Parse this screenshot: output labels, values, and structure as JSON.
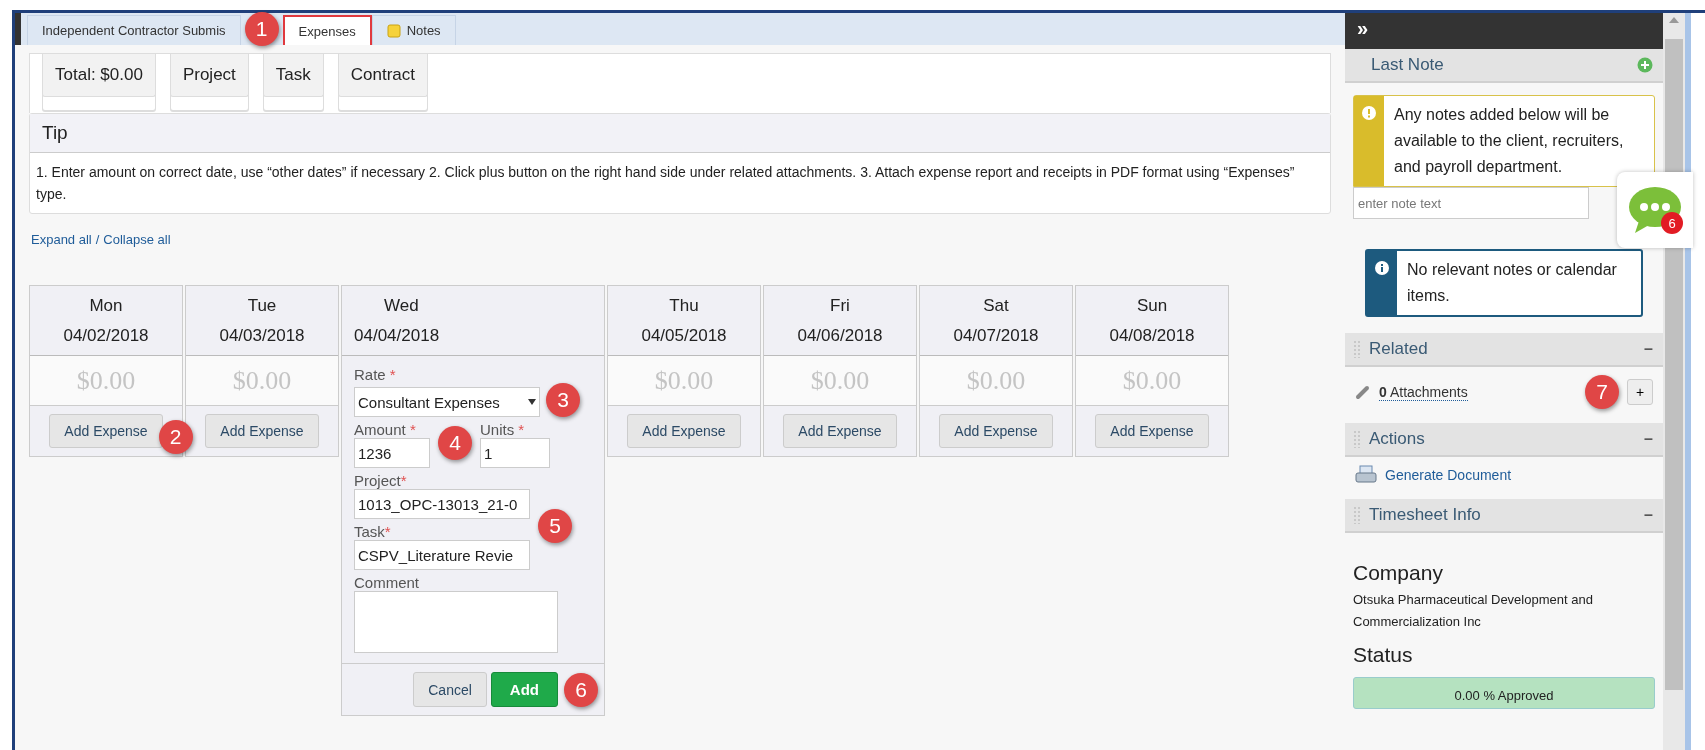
{
  "tabs": [
    {
      "label": "Independent Contractor Submis",
      "selected": false,
      "kind": "plain"
    },
    {
      "label": "Expenses",
      "selected": true,
      "kind": "plain"
    },
    {
      "label": "Notes",
      "selected": false,
      "kind": "note"
    }
  ],
  "summary": [
    "Total: $0.00",
    "Project",
    "Task",
    "Contract"
  ],
  "tip": {
    "title": "Tip",
    "text": "1. Enter amount on correct date, use “other dates” if necessary 2. Click plus button on the right hand side under related attachments. 3. Attach expense report and receipts in PDF format using “Expenses” type."
  },
  "expand_links": {
    "expand": "Expand all",
    "separator": "/",
    "collapse": "Collapse all"
  },
  "days": [
    {
      "day": "Mon",
      "date": "04/02/2018",
      "amount": "$0.00",
      "button": "Add Expense",
      "expanded": false
    },
    {
      "day": "Tue",
      "date": "04/03/2018",
      "amount": "$0.00",
      "button": "Add Expense",
      "expanded": false
    },
    {
      "day": "Wed",
      "date": "04/04/2018",
      "expanded": true
    },
    {
      "day": "Thu",
      "date": "04/05/2018",
      "amount": "$0.00",
      "button": "Add Expense",
      "expanded": false
    },
    {
      "day": "Fri",
      "date": "04/06/2018",
      "amount": "$0.00",
      "button": "Add Expense",
      "expanded": false
    },
    {
      "day": "Sat",
      "date": "04/07/2018",
      "amount": "$0.00",
      "button": "Add Expense",
      "expanded": false
    },
    {
      "day": "Sun",
      "date": "04/08/2018",
      "amount": "$0.00",
      "button": "Add Expense",
      "expanded": false
    }
  ],
  "expense_form": {
    "required_mark": "*",
    "rate": {
      "label": "Rate",
      "value": "Consultant Expenses"
    },
    "amount": {
      "label": "Amount",
      "value": "1236"
    },
    "units": {
      "label": "Units",
      "value": "1"
    },
    "project": {
      "label": "Project",
      "value": "1013_OPC-13013_21-0"
    },
    "task": {
      "label": "Task",
      "value": "CSPV_Literature Revie"
    },
    "comment": {
      "label": "Comment"
    },
    "cancel": "Cancel",
    "add": "Add"
  },
  "sidebar": {
    "toggle": "»",
    "last_note": {
      "title": "Last Note",
      "warning": "Any notes added below will be available to the client, recruiters, and payroll department.",
      "placeholder": "enter note text"
    },
    "info": "No relevant notes or calendar items.",
    "related": {
      "title": "Related",
      "collapse": "–",
      "count": "0",
      "label": "Attachments",
      "add": "+"
    },
    "actions": {
      "title": "Actions",
      "collapse": "–",
      "link": "Generate Document"
    },
    "timesheet_info": {
      "title": "Timesheet Info",
      "collapse": "–",
      "company_label": "Company",
      "company": "Otsuka Pharmaceutical Development and Commercialization Inc",
      "status_label": "Status",
      "status": "0.00 % Approved"
    }
  },
  "chat": {
    "badge": "6"
  },
  "callouts": [
    "1",
    "2",
    "3",
    "4",
    "5",
    "6",
    "7"
  ]
}
